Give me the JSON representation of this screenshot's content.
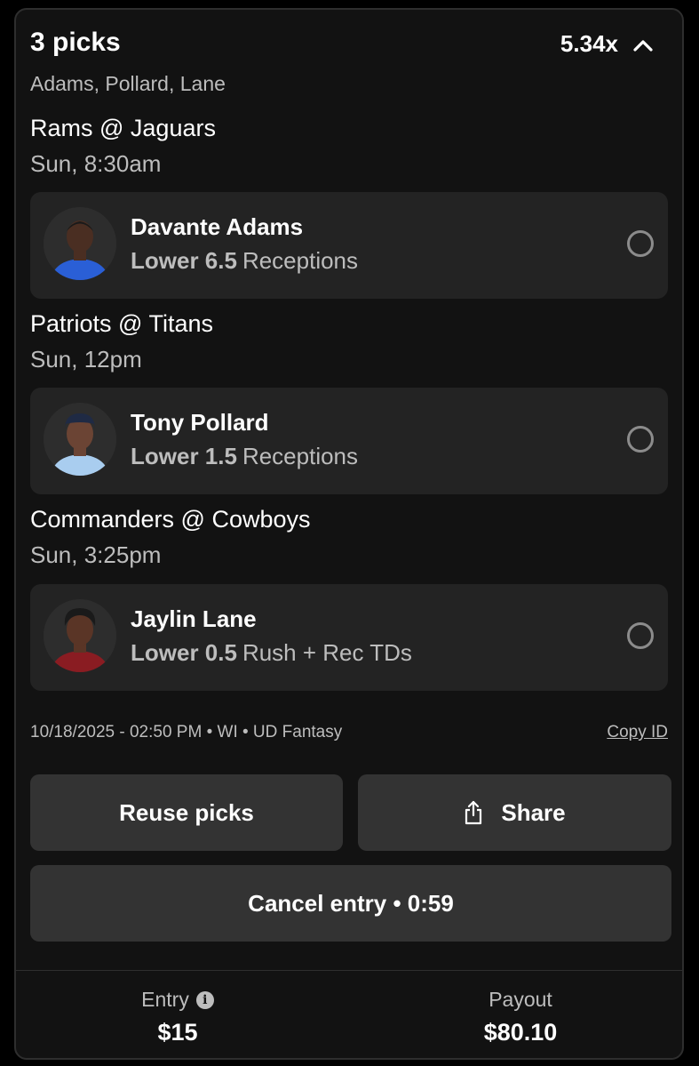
{
  "header": {
    "title": "3 picks",
    "multiplier": "5.34x",
    "players_summary": "Adams, Pollard, Lane"
  },
  "games": [
    {
      "matchup": "Rams @ Jaguars",
      "time": "Sun, 8:30am",
      "pick": {
        "player": "Davante Adams",
        "direction": "Lower 6.5",
        "stat": "Receptions",
        "jersey_color": "#2a5fd6",
        "skin_color": "#4a2e22"
      }
    },
    {
      "matchup": "Patriots @ Titans",
      "time": "Sun, 12pm",
      "pick": {
        "player": "Tony Pollard",
        "direction": "Lower 1.5",
        "stat": "Receptions",
        "jersey_color": "#a9cdef",
        "skin_color": "#6b4434"
      }
    },
    {
      "matchup": "Commanders @ Cowboys",
      "time": "Sun, 3:25pm",
      "pick": {
        "player": "Jaylin Lane",
        "direction": "Lower 0.5",
        "stat": "Rush + Rec TDs",
        "jersey_color": "#8a1c22",
        "skin_color": "#5a3526"
      }
    }
  ],
  "meta": {
    "info": "10/18/2025 - 02:50 PM • WI • UD Fantasy",
    "copy_id": "Copy ID"
  },
  "actions": {
    "reuse": "Reuse picks",
    "share": "Share",
    "cancel": "Cancel entry • 0:59"
  },
  "footer": {
    "entry_label": "Entry",
    "entry_value": "$15",
    "payout_label": "Payout",
    "payout_value": "$80.10"
  },
  "colors": {
    "background": "#000000",
    "card": "#121212",
    "pick_card": "#232323",
    "button": "#333333",
    "muted_text": "#bdbdbd"
  },
  "icons": {
    "collapse": "chevron-up-icon",
    "share": "share-icon",
    "info": "info-icon",
    "pick_status": "radio-icon"
  }
}
